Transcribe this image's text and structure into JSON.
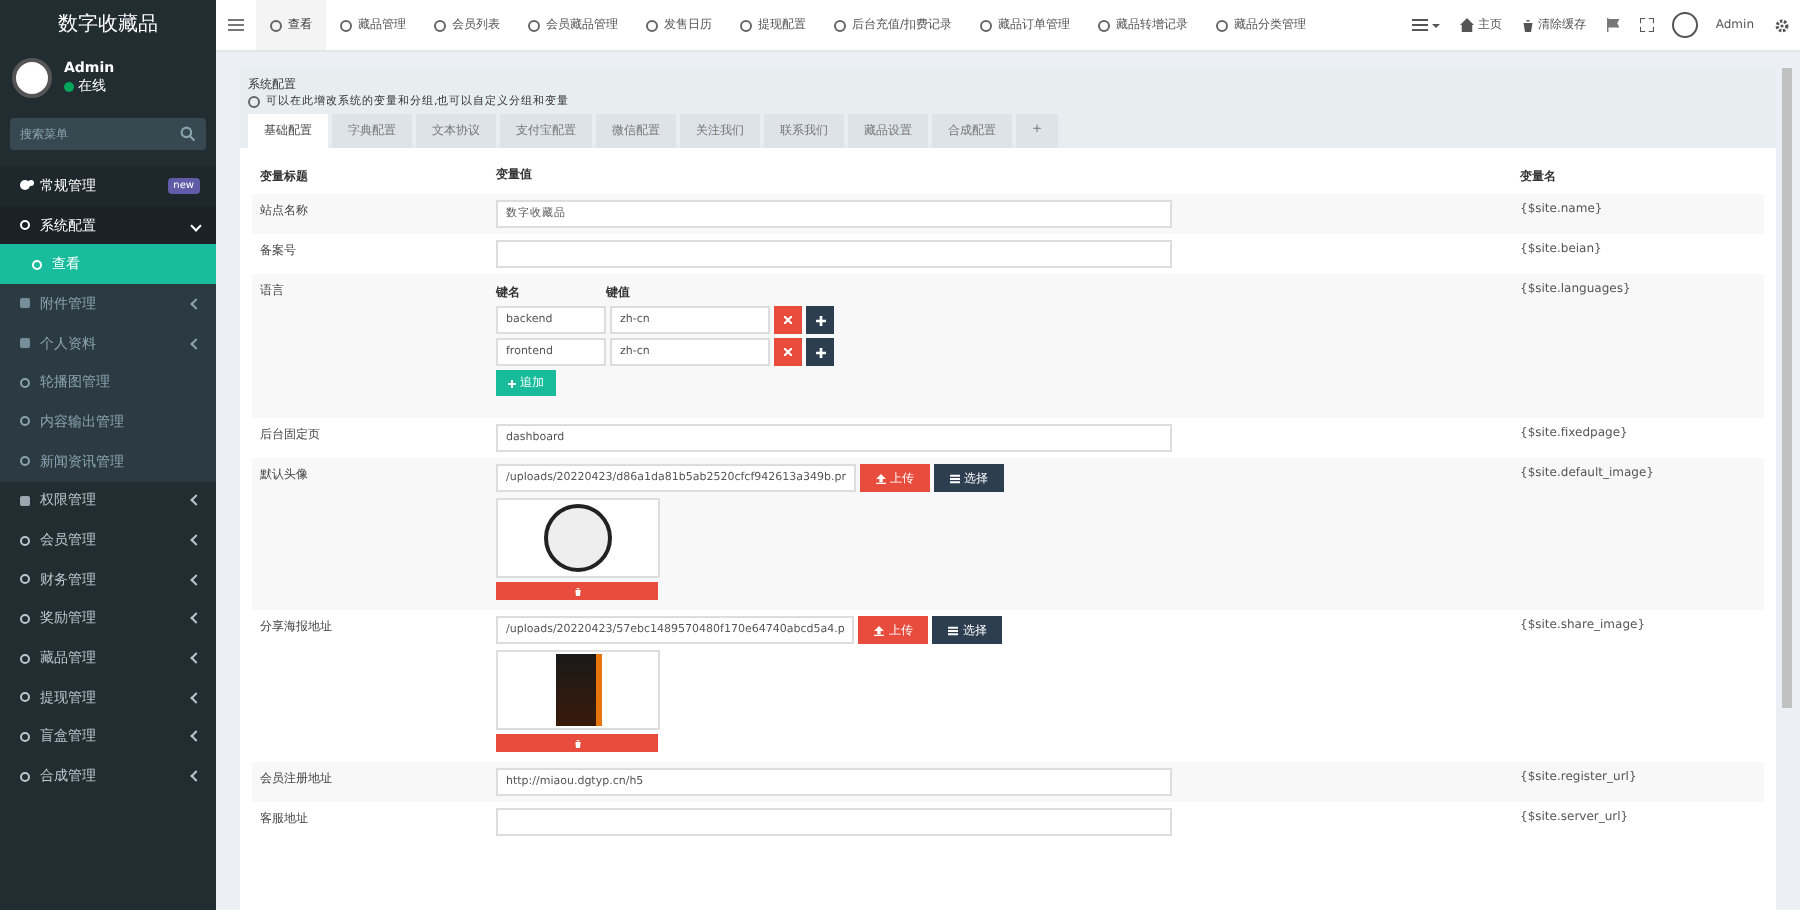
{
  "sidebar": {
    "app_title": "数字收藏品",
    "user": {
      "name": "Admin",
      "status": "在线",
      "online": true
    },
    "search": {
      "placeholder": "搜索菜单"
    },
    "items": [
      {
        "label": "常规管理",
        "badge": "new",
        "expanded": true,
        "selected": false,
        "children": [
          {
            "label": "系统配置",
            "expanded": true,
            "selected": false,
            "children": [
              {
                "label": "查看",
                "selected": true
              }
            ]
          },
          {
            "label": "附件管理",
            "expanded": false,
            "selected": false
          },
          {
            "label": "个人资料",
            "expanded": false,
            "selected": false
          },
          {
            "label": "轮播图管理",
            "selected": false
          },
          {
            "label": "内容输出管理",
            "selected": false
          },
          {
            "label": "新闻资讯管理",
            "selected": false
          }
        ]
      },
      {
        "label": "权限管理",
        "expanded": false,
        "selected": false
      },
      {
        "label": "会员管理",
        "expanded": false,
        "selected": false
      },
      {
        "label": "财务管理",
        "expanded": false,
        "selected": false
      },
      {
        "label": "奖励管理",
        "expanded": false,
        "selected": false
      },
      {
        "label": "藏品管理",
        "expanded": false,
        "selected": false
      },
      {
        "label": "提现管理",
        "expanded": false,
        "selected": false
      },
      {
        "label": "盲盒管理",
        "expanded": false,
        "selected": false
      },
      {
        "label": "合成管理",
        "expanded": false,
        "selected": false
      }
    ]
  },
  "top_tabs": [
    {
      "label": "查看",
      "selected": true
    },
    {
      "label": "藏品管理",
      "selected": false
    },
    {
      "label": "会员列表",
      "selected": false
    },
    {
      "label": "会员藏品管理",
      "selected": false
    },
    {
      "label": "发售日历",
      "selected": false
    },
    {
      "label": "提现配置",
      "selected": false
    },
    {
      "label": "后台充值/扣费记录",
      "selected": false
    },
    {
      "label": "藏品订单管理",
      "selected": false
    },
    {
      "label": "藏品转增记录",
      "selected": false
    },
    {
      "label": "藏品分类管理",
      "selected": false
    }
  ],
  "top_right": {
    "home": "主页",
    "clear_cache": "清除缓存",
    "user": "Admin"
  },
  "panel": {
    "title": "系统配置",
    "subtitle": "可以在此增改系统的变量和分组,也可以自定义分组和变量",
    "tabs": [
      {
        "label": "基础配置",
        "selected": true
      },
      {
        "label": "字典配置",
        "selected": false
      },
      {
        "label": "文本协议",
        "selected": false
      },
      {
        "label": "支付宝配置",
        "selected": false
      },
      {
        "label": "微信配置",
        "selected": false
      },
      {
        "label": "关注我们",
        "selected": false
      },
      {
        "label": "联系我们",
        "selected": false
      },
      {
        "label": "藏品设置",
        "selected": false
      },
      {
        "label": "合成配置",
        "selected": false
      }
    ],
    "add_tab": "+",
    "columns": [
      "变量标题",
      "变量值",
      "变量名"
    ],
    "rows": [
      {
        "kind": "text",
        "title": "站点名称",
        "value": "数字收藏品",
        "name": "{$site.name}"
      },
      {
        "kind": "text",
        "title": "备案号",
        "value": "",
        "name": "{$site.beian}"
      },
      {
        "kind": "array",
        "title": "语言",
        "key_header": "键名",
        "value_header": "键值",
        "pairs": [
          {
            "key": "backend",
            "value": "zh-cn"
          },
          {
            "key": "frontend",
            "value": "zh-cn"
          }
        ],
        "add_label": "追加",
        "name": "{$site.languages}"
      },
      {
        "kind": "text",
        "title": "后台固定页",
        "value": "dashboard",
        "name": "{$site.fixedpage}"
      },
      {
        "kind": "avatar",
        "title": "默认头像",
        "value": "/uploads/20220423/d86a1da81b5ab2520cfcf942613a349b.pr",
        "upload": "上传",
        "choose": "选择",
        "name": "{$site.default_image}"
      },
      {
        "kind": "poster",
        "title": "分享海报地址",
        "value": "/uploads/20220423/57ebc1489570480f170e64740abcd5a4.p",
        "upload": "上传",
        "choose": "选择",
        "name": "{$site.share_image}"
      },
      {
        "kind": "text",
        "title": "会员注册地址",
        "value": "http://miaou.dgtyp.cn/h5",
        "name": "{$site.register_url}"
      },
      {
        "kind": "text",
        "title": "客服地址",
        "value": "",
        "name": "{$site.server_url}"
      }
    ]
  }
}
